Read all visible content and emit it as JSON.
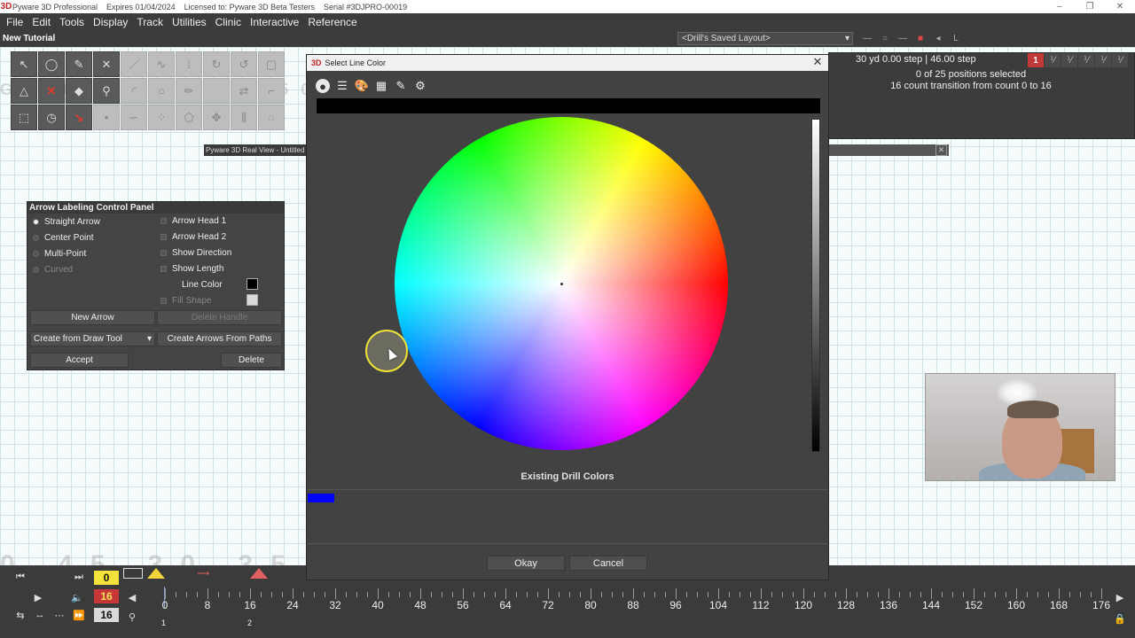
{
  "titlebar": {
    "logo": "3D",
    "app": "Pyware 3D Professional",
    "expires": "Expires 01/04/2024",
    "license": "Licensed to: Pyware 3D Beta Testers",
    "serial": "Serial #3DJPRO-00019"
  },
  "menu": [
    "File",
    "Edit",
    "Tools",
    "Display",
    "Track",
    "Utilities",
    "Clinic",
    "Interactive",
    "Reference"
  ],
  "document_title": "New Tutorial",
  "layout_select": "<Drill's Saved Layout>",
  "info_panel": {
    "step_readout": "30 yd 0.00 step | 46.00 step",
    "positions_selected": "0 of 25 positions selected",
    "transition": "16 count transition from count 0 to 16",
    "icon_labels": [
      "1",
      "L",
      "T"
    ]
  },
  "real_view_title": "Pyware 3D Real View - Untitled",
  "arrow_panel": {
    "title": "Arrow Labeling Control Panel",
    "arrow_types": [
      "Straight Arrow",
      "Center Point",
      "Multi-Point",
      "Curved"
    ],
    "options": [
      "Arrow Head 1",
      "Arrow Head 2",
      "Show Direction",
      "Show Length"
    ],
    "line_color_label": "Line Color",
    "fill_shape_label": "Fill Shape",
    "new_arrow": "New Arrow",
    "delete_handle": "Delete Handle",
    "create_from": "Create from Draw Tool",
    "create_paths": "Create Arrows From Paths",
    "accept": "Accept",
    "delete": "Delete",
    "line_color": "#000000",
    "fill_color": "#d9d9d9"
  },
  "dialog": {
    "logo": "3D",
    "title": "Select Line Color",
    "preview_color": "#000000",
    "existing_title": "Existing Drill Colors",
    "existing_color": "#0000ff",
    "okay": "Okay",
    "cancel": "Cancel"
  },
  "timeline": {
    "count_current": "0",
    "count_red": "16",
    "count_total": "16",
    "ticks": [
      "0",
      "8",
      "16",
      "24",
      "32",
      "40",
      "48",
      "56",
      "64",
      "72",
      "80",
      "88",
      "96",
      "104",
      "112",
      "120",
      "128",
      "136",
      "144",
      "152",
      "160",
      "168",
      "176"
    ],
    "sub_labels": [
      "1",
      "2"
    ]
  }
}
